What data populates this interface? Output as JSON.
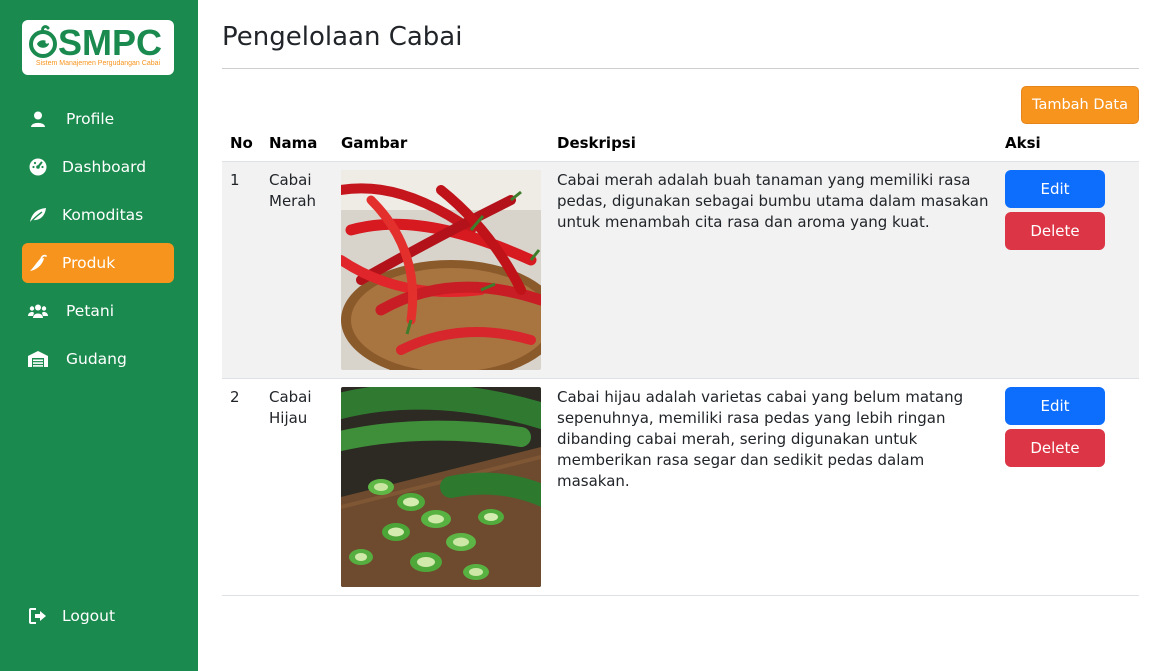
{
  "app": {
    "logo_text": "SMPC",
    "logo_subtitle": "Sistem Manajemen Pergudangan Cabai"
  },
  "sidebar": {
    "items": [
      {
        "label": "Profile",
        "icon": "user-icon"
      },
      {
        "label": "Dashboard",
        "icon": "dashboard-icon"
      },
      {
        "label": "Komoditas",
        "icon": "leaf-icon"
      },
      {
        "label": "Produk",
        "icon": "chili-icon",
        "active": true
      },
      {
        "label": "Petani",
        "icon": "users-icon"
      },
      {
        "label": "Gudang",
        "icon": "warehouse-icon"
      }
    ],
    "logout_label": "Logout"
  },
  "page": {
    "title": "Pengelolaan Cabai",
    "add_button": "Tambah Data"
  },
  "table": {
    "headers": [
      "No",
      "Nama",
      "Gambar",
      "Deskripsi",
      "Aksi"
    ],
    "rows": [
      {
        "no": "1",
        "nama": "Cabai Merah",
        "deskripsi": "Cabai merah adalah buah tanaman yang memiliki rasa pedas, digunakan sebagai bumbu utama dalam masakan untuk menambah cita rasa dan aroma yang kuat.",
        "edit": "Edit",
        "delete": "Delete"
      },
      {
        "no": "2",
        "nama": "Cabai Hijau",
        "deskripsi": "Cabai hijau adalah varietas cabai yang belum matang sepenuhnya, memiliki rasa pedas yang lebih ringan dibanding cabai merah, sering digunakan untuk memberikan rasa segar dan sedikit pedas dalam masakan.",
        "edit": "Edit",
        "delete": "Delete"
      }
    ]
  },
  "colors": {
    "sidebar": "#1a8a4e",
    "accent": "#f7941d",
    "edit": "#0d6efd",
    "delete": "#dc3545"
  }
}
